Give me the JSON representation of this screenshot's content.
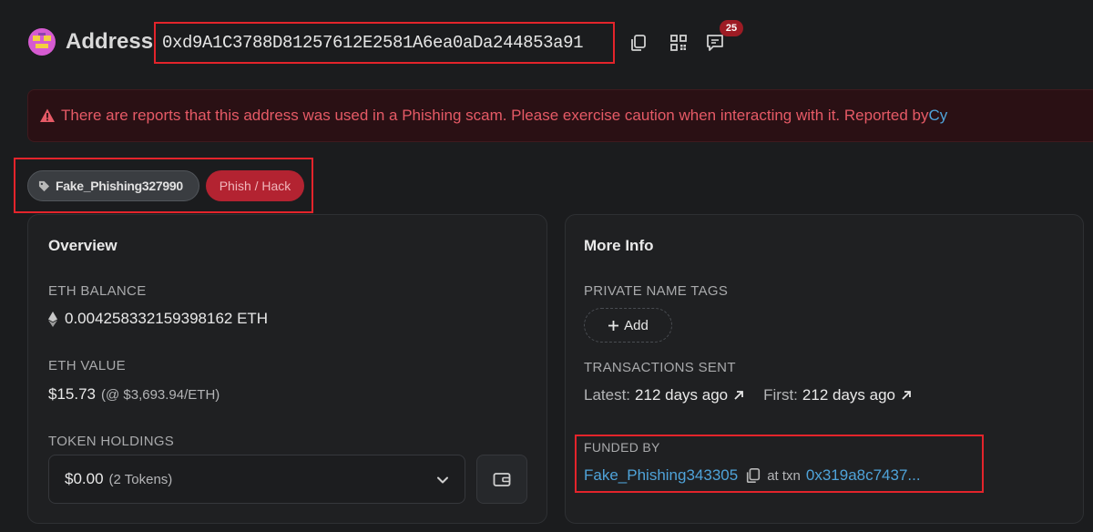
{
  "header": {
    "title": "Address",
    "address": "0xd9A1C3788D81257612E2581A6ea0aDa244853a91",
    "comment_count": "25"
  },
  "alert": {
    "text": "There are reports that this address was used in a Phishing scam. Please exercise caution when interacting with it. Reported by ",
    "reporter": "Cy"
  },
  "tags": {
    "name_tag": "Fake_Phishing327990",
    "category_tag": "Phish / Hack"
  },
  "overview": {
    "title": "Overview",
    "eth_balance_label": "ETH BALANCE",
    "eth_balance_value": "0.004258332159398162 ETH",
    "eth_value_label": "ETH VALUE",
    "eth_value_amount": "$15.73",
    "eth_value_rate": "(@ $3,693.94/ETH)",
    "token_holdings_label": "TOKEN HOLDINGS",
    "token_holdings_value": "$0.00",
    "token_holdings_count": "(2 Tokens)"
  },
  "more_info": {
    "title": "More Info",
    "private_name_tags_label": "PRIVATE NAME TAGS",
    "add_label": "Add",
    "transactions_sent_label": "TRANSACTIONS SENT",
    "latest_label": "Latest:",
    "latest_value": "212 days ago",
    "first_label": "First:",
    "first_value": "212 days ago",
    "funded_by_label": "FUNDED BY",
    "funded_by_name": "Fake_Phishing343305",
    "at_txn_label": "at txn",
    "txn_hash": "0x319a8c7437..."
  },
  "colors": {
    "background": "#1b1c1e",
    "alert_text": "#e65a66",
    "link": "#4fa3d9",
    "phish_tag": "#b32331",
    "highlight_box": "#e3242b"
  }
}
